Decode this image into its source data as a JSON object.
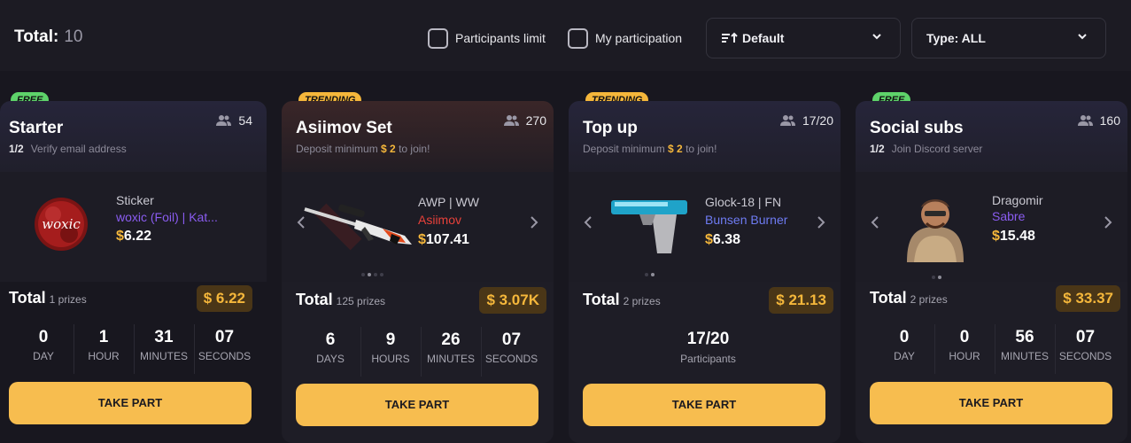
{
  "header": {
    "total_label": "Total:",
    "total_value": "10",
    "participants_limit_label": "Participants limit",
    "my_participation_label": "My participation",
    "sort_value": "Default",
    "type_value": "Type: ALL"
  },
  "colors": {
    "accent": "#f7bd4f",
    "free": "#5ed36a",
    "trending": "#f5b73b",
    "background": "#18171f"
  },
  "cards": [
    {
      "badge": "FREE",
      "title": "Starter",
      "people": "54",
      "sub_step": "1/2",
      "sub_text": "Verify email address",
      "prize_type": "Sticker",
      "prize_name": "woxic (Foil) | Kat...",
      "prize_currency": "$",
      "prize_price": "6.22",
      "logo_text": "woxic",
      "total_label": "Total",
      "prizes_count": "1 prizes",
      "total_value": "$ 6.22",
      "timer": [
        {
          "n": "0",
          "l": "DAY"
        },
        {
          "n": "1",
          "l": "HOUR"
        },
        {
          "n": "31",
          "l": "MINUTES"
        },
        {
          "n": "07",
          "l": "SECONDS"
        }
      ],
      "button": "TAKE PART"
    },
    {
      "badge": "TRENDING",
      "title": "Asiimov Set",
      "people": "270",
      "sub_pre": "Deposit minimum",
      "sub_amount": "$ 2",
      "sub_post": "to join!",
      "prize_type": "AWP | WW",
      "prize_name": "Asiimov",
      "prize_currency": "$",
      "prize_price": "107.41",
      "total_label": "Total",
      "prizes_count": "125 prizes",
      "total_value": "$ 3.07K",
      "timer": [
        {
          "n": "6",
          "l": "DAYS"
        },
        {
          "n": "9",
          "l": "HOURS"
        },
        {
          "n": "26",
          "l": "MINUTES"
        },
        {
          "n": "07",
          "l": "SECONDS"
        }
      ],
      "button": "TAKE PART"
    },
    {
      "badge": "TRENDING",
      "title": "Top up",
      "people": "17/20",
      "sub_pre": "Deposit minimum",
      "sub_amount": "$ 2",
      "sub_post": "to join!",
      "prize_type": "Glock-18 | FN",
      "prize_name": "Bunsen Burner",
      "prize_currency": "$",
      "prize_price": "6.38",
      "total_label": "Total",
      "prizes_count": "2 prizes",
      "total_value": "$ 21.13",
      "participants_value": "17/20",
      "participants_label": "Participants",
      "button": "TAKE PART"
    },
    {
      "badge": "FREE",
      "title": "Social subs",
      "people": "160",
      "sub_step": "1/2",
      "sub_text": "Join Discord server",
      "prize_type": "Dragomir",
      "prize_name": "Sabre",
      "prize_currency": "$",
      "prize_price": "15.48",
      "total_label": "Total",
      "prizes_count": "2 prizes",
      "total_value": "$ 33.37",
      "timer": [
        {
          "n": "0",
          "l": "DAY"
        },
        {
          "n": "0",
          "l": "HOUR"
        },
        {
          "n": "56",
          "l": "MINUTES"
        },
        {
          "n": "07",
          "l": "SECONDS"
        }
      ],
      "button": "TAKE PART"
    }
  ]
}
